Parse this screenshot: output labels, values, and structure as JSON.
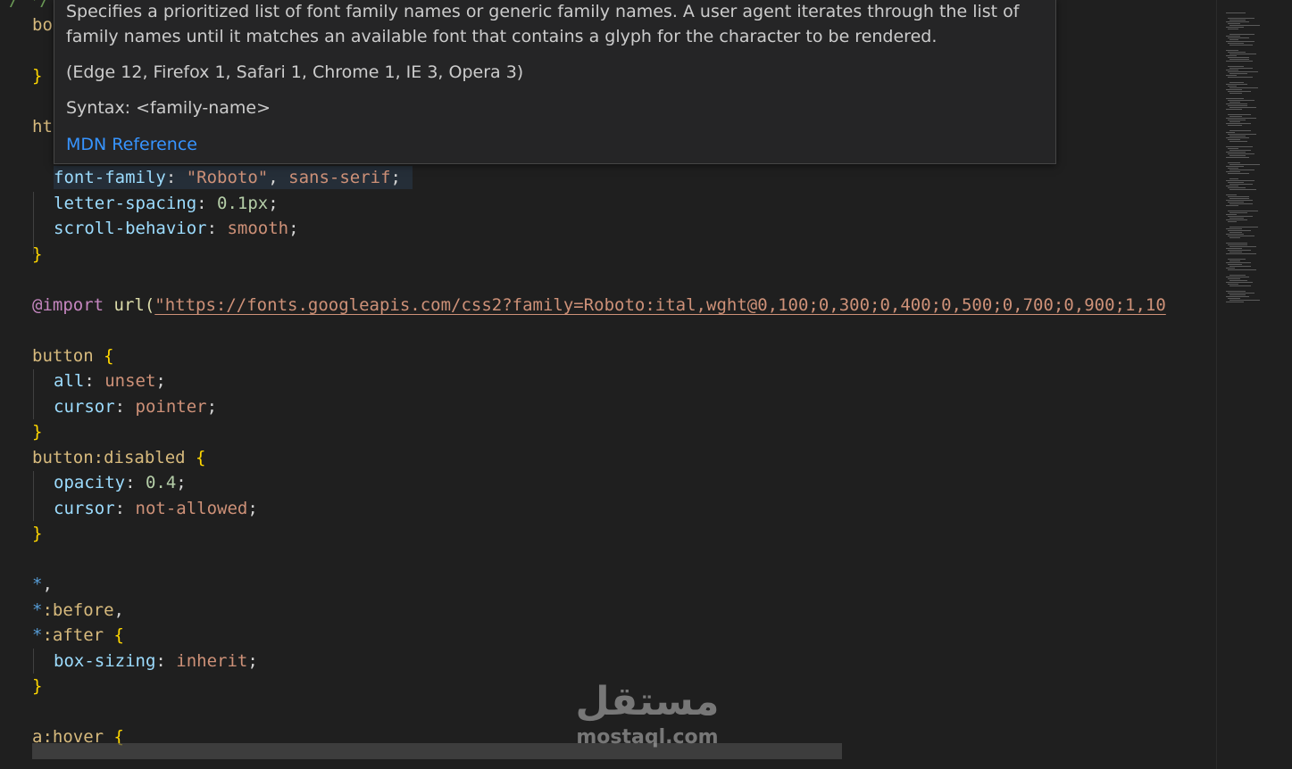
{
  "hover": {
    "description": "Specifies a prioritized list of font family names or generic family names. A user agent iterates through the list of family names until it matches an available font that contains a glyph for the character to be rendered.",
    "compatibility": "(Edge 12, Firefox 1, Safari 1, Chrome 1, IE 3, Opera 3)",
    "syntax": "Syntax: <family-name>",
    "mdn_link": "MDN Reference"
  },
  "code": {
    "body_sel": "bo",
    "close_brace": "}",
    "html_sel": "ht",
    "font_family_prop": "font-family",
    "font_family_roboto": "\"Roboto\"",
    "font_family_generic": "sans-serif",
    "letter_spacing_prop": "letter-spacing",
    "letter_spacing_val": "0.1px",
    "scroll_behavior_prop": "scroll-behavior",
    "scroll_behavior_val": "smooth",
    "import_kw": "@import",
    "url_fn": "url(",
    "import_url": "\"https://fonts.googleapis.com/css2?family=Roboto:ital,wght@0,100;0,300;0,400;0,500;0,700;0,900;1,10",
    "button_sel": "button",
    "all_prop": "all",
    "all_val": "unset",
    "cursor_prop": "cursor",
    "cursor_pointer": "pointer",
    "button_disabled_sel": "button:disabled",
    "opacity_prop": "opacity",
    "opacity_val": "0.4",
    "cursor_not_allowed": "not-allowed",
    "star": "*",
    "before_sel": ":before",
    "after_sel": ":after",
    "box_sizing_prop": "box-sizing",
    "box_sizing_val": "inherit",
    "a_hover_sel": "a:hover",
    "open_brace": "{"
  },
  "watermark": {
    "arabic": "مستقل",
    "latin": "mostaql.com"
  },
  "colors": {
    "background": "#1f1f1f",
    "selector": "#d7ba7d",
    "property": "#9cdcfe",
    "value": "#ce9178",
    "number": "#b5cea8",
    "brace": "#ffd700",
    "link": "#3794ff"
  }
}
